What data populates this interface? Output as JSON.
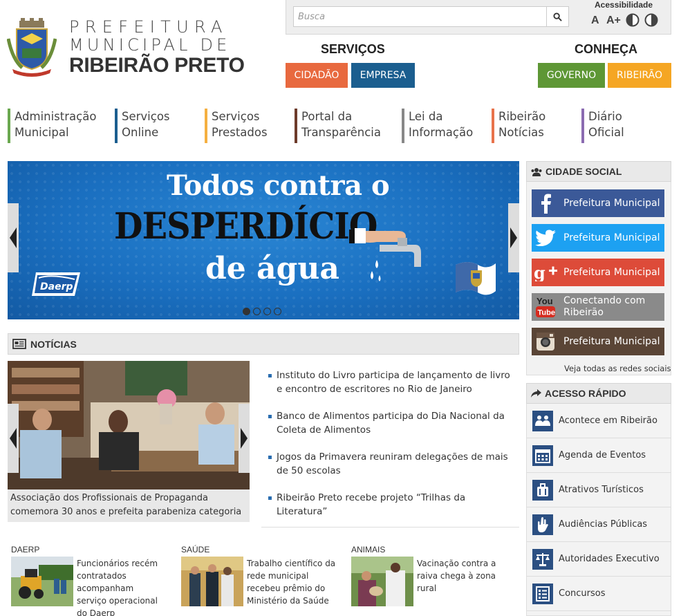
{
  "header": {
    "brand_line1": "PREFEITURA",
    "brand_line2": "MUNICIPAL DE",
    "brand_line3": "RIBEIRÃO PRETO",
    "search_placeholder": "Busca",
    "accessibility_title": "Acessibilidade",
    "font_normal": "A",
    "font_bigger": "A+",
    "services_title": "SERVIÇOS",
    "know_title": "CONHEÇA",
    "btn_cidadao": "CIDADÃO",
    "btn_empresa": "EMPRESA",
    "btn_governo": "GOVERNO",
    "btn_ribeirao": "RIBEIRÃO"
  },
  "nav": [
    {
      "l1": "Administração",
      "l2": "Municipal",
      "color": "#6aa84f"
    },
    {
      "l1": "Serviços",
      "l2": "Online",
      "color": "#1b5e8f"
    },
    {
      "l1": "Serviços",
      "l2": "Prestados",
      "color": "#f5b041"
    },
    {
      "l1": "Portal da",
      "l2": "Transparência",
      "color": "#6d3b2b"
    },
    {
      "l1": "Lei da",
      "l2": "Informação",
      "color": "#888888"
    },
    {
      "l1": "Ribeirão",
      "l2": "Notícias",
      "color": "#e8734b"
    },
    {
      "l1": "Diário",
      "l2": "Oficial",
      "color": "#8b6bb1"
    }
  ],
  "banner": {
    "line1": "Todos contra o",
    "line2": "DESPERDÍCIO",
    "line3": "de água",
    "logo_text": "Daerp"
  },
  "social": {
    "title": "CIDADE SOCIAL",
    "items": [
      {
        "label": "Prefeitura Municipal",
        "icon": "facebook-icon",
        "color": "#3b5998"
      },
      {
        "label": "Prefeitura Municipal",
        "icon": "twitter-icon",
        "color": "#1da1f2"
      },
      {
        "label": "Prefeitura Municipal",
        "icon": "google-plus-icon",
        "color": "#dd4b39"
      },
      {
        "label_l1": "Conectando com",
        "label_l2": "Ribeirão",
        "icon": "youtube-icon",
        "color": "#8a8a8a"
      },
      {
        "label": "Prefeitura Municipal",
        "icon": "instagram-icon",
        "color": "#5a4536"
      }
    ],
    "see_all": "Veja todas as redes sociais"
  },
  "quick_access": {
    "title": "ACESSO RÁPIDO",
    "items": [
      "Acontece em Ribeirão",
      "Agenda de Eventos",
      "Atrativos Turísticos",
      "Audiências Públicas",
      "Autoridades Executivo",
      "Concursos"
    ]
  },
  "news": {
    "title": "NOTÍCIAS",
    "caption": "Associação dos Profissionais de Propaganda comemora 30 anos e prefeita parabeniza categoria",
    "items": [
      "Instituto do Livro participa de lançamento de livro e encontro de escritores no Rio de Janeiro",
      "Banco de Alimentos participa do Dia Nacional da Coleta de Alimentos",
      "Jogos da Primavera reuniram delegações de mais de 50 escolas",
      "Ribeirão Preto recebe projeto “Trilhas da Literatura”"
    ],
    "categories": [
      {
        "name": "DAERP",
        "text": "Funcionários recém contratados acompanham serviço operacional do Daerp"
      },
      {
        "name": "SAÚDE",
        "text": "Trabalho científico da rede municipal recebeu prêmio do Ministério da Saúde"
      },
      {
        "name": "ANIMAIS",
        "text": "Vacinação contra a raiva chega à zona rural"
      }
    ]
  }
}
